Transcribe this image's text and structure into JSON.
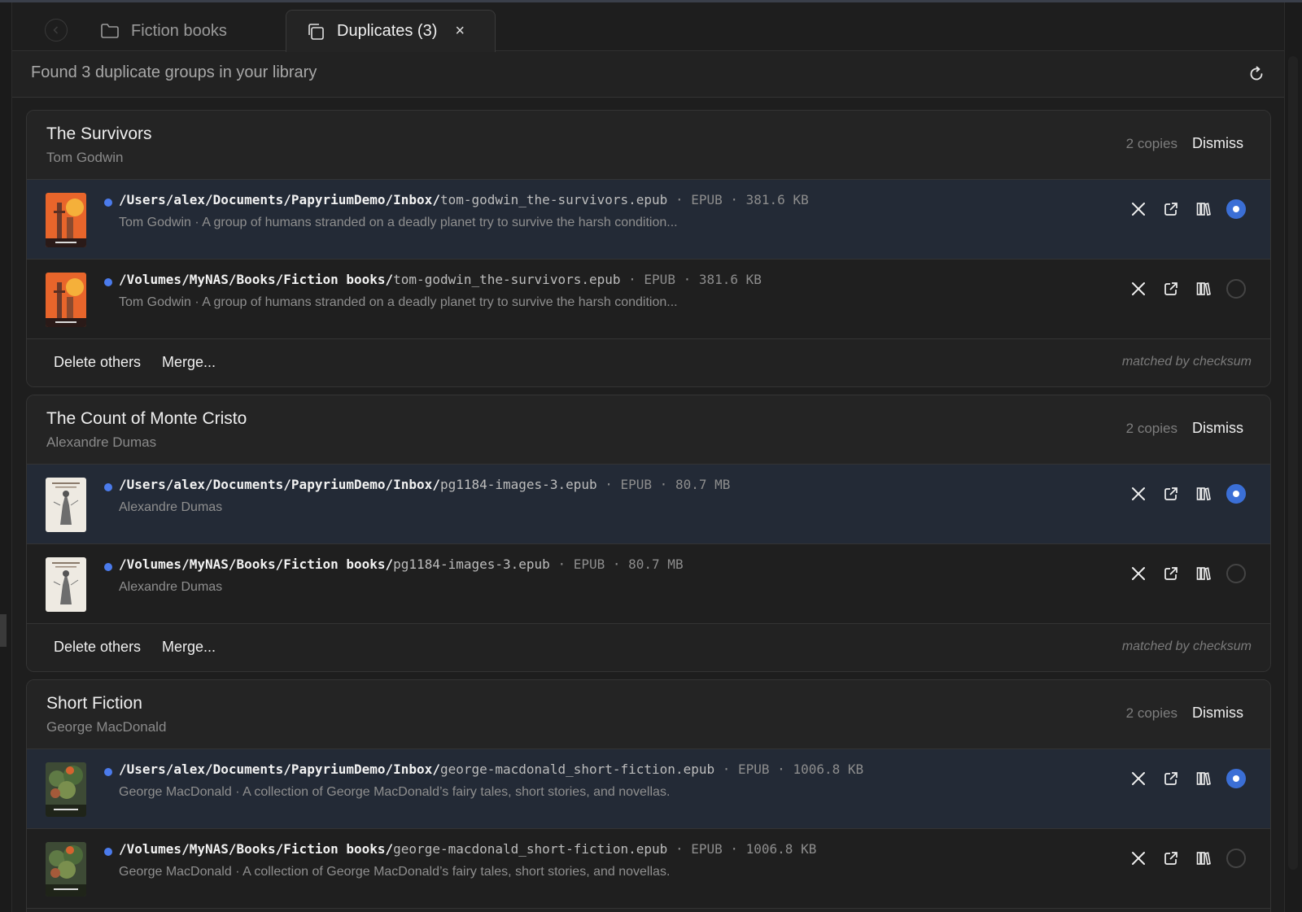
{
  "tabs": {
    "back_label": "‹",
    "fiction_label": "Fiction books",
    "duplicates_label": "Duplicates (3)",
    "close_label": "×"
  },
  "summary": {
    "prefix": "Found",
    "highlight": "3 duplicate groups",
    "suffix": "in your library"
  },
  "actions": {
    "dismiss_label": "Dismiss",
    "delete_others_label": "Delete others",
    "merge_label": "Merge...",
    "matched_label": "matched by checksum"
  },
  "groups": [
    {
      "title": "The Survivors",
      "author": "Tom Godwin",
      "copies": "2 copies",
      "cover": "orange",
      "files": [
        {
          "dir": "/Users/alex/Documents/PapyriumDemo/Inbox/",
          "file": "tom-godwin_the-survivors.epub",
          "meta": " · EPUB · 381.6 KB",
          "desc": "Tom Godwin · A group of humans stranded on a deadly planet try to survive the harsh condition...",
          "selected": true
        },
        {
          "dir": "/Volumes/MyNAS/Books/Fiction books/",
          "file": "tom-godwin_the-survivors.epub",
          "meta": " · EPUB · 381.6 KB",
          "desc": "Tom Godwin · A group of humans stranded on a deadly planet try to survive the harsh condition...",
          "selected": false
        }
      ]
    },
    {
      "title": "The Count of Monte Cristo",
      "author": "Alexandre Dumas",
      "copies": "2 copies",
      "cover": "paper",
      "files": [
        {
          "dir": "/Users/alex/Documents/PapyriumDemo/Inbox/",
          "file": "pg1184-images-3.epub",
          "meta": " · EPUB · 80.7 MB",
          "desc": "Alexandre Dumas",
          "selected": true
        },
        {
          "dir": "/Volumes/MyNAS/Books/Fiction books/",
          "file": "pg1184-images-3.epub",
          "meta": " · EPUB · 80.7 MB",
          "desc": "Alexandre Dumas",
          "selected": false
        }
      ]
    },
    {
      "title": "Short Fiction",
      "author": "George MacDonald",
      "copies": "2 copies",
      "cover": "forest",
      "files": [
        {
          "dir": "/Users/alex/Documents/PapyriumDemo/Inbox/",
          "file": "george-macdonald_short-fiction.epub",
          "meta": " · EPUB · 1006.8 KB",
          "desc": "George MacDonald · A collection of George MacDonald’s fairy tales, short stories, and novellas.",
          "selected": true
        },
        {
          "dir": "/Volumes/MyNAS/Books/Fiction books/",
          "file": "george-macdonald_short-fiction.epub",
          "meta": " · EPUB · 1006.8 KB",
          "desc": "George MacDonald · A collection of George MacDonald’s fairy tales, short stories, and novellas.",
          "selected": false
        }
      ]
    }
  ],
  "icons": {
    "folder": "folder-icon",
    "duplicates": "copy-icon",
    "refresh": "refresh-icon",
    "remove": "close-icon",
    "open": "external-link-icon",
    "library": "library-icon"
  },
  "colors": {
    "accent": "#3b6fd6",
    "dot": "#4b7bec",
    "selected_row": "#232a36"
  }
}
